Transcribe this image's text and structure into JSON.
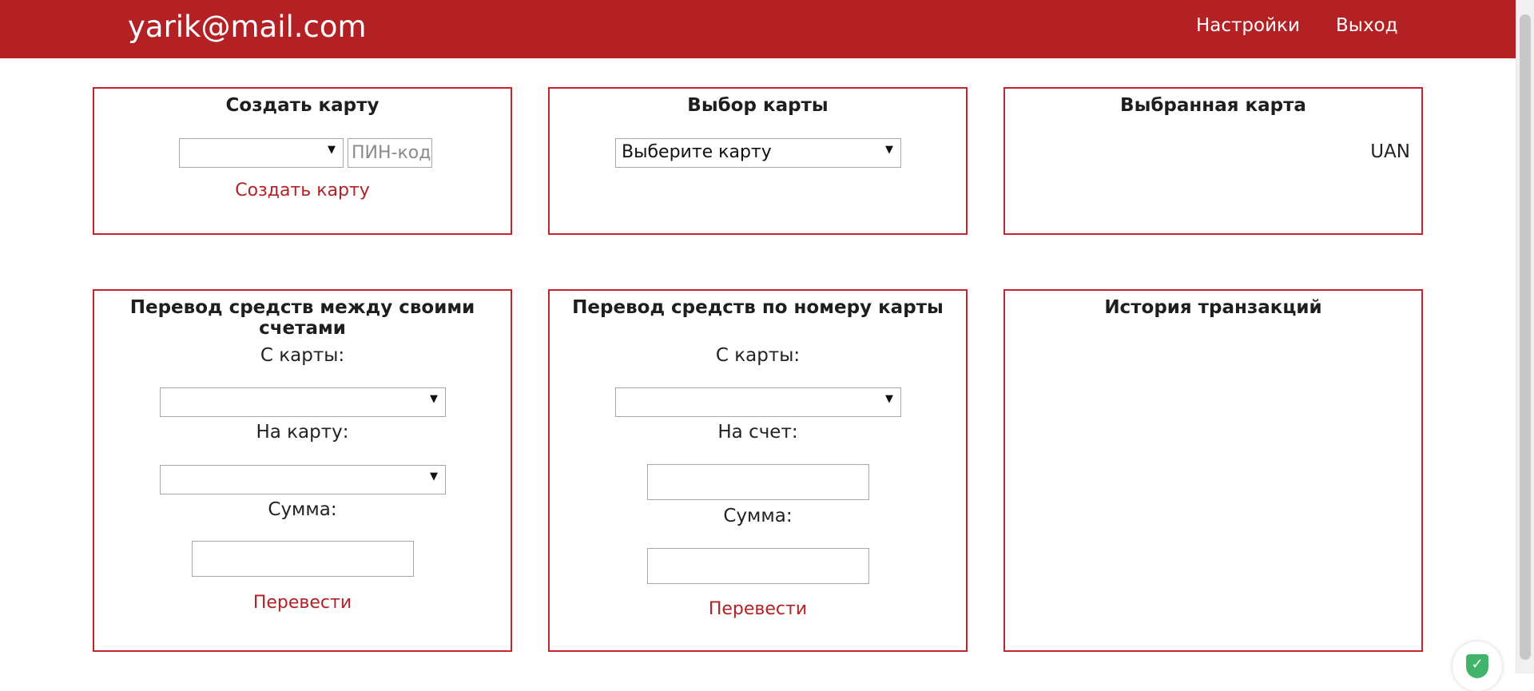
{
  "header": {
    "email": "yarik@mail.com",
    "nav": {
      "settings": "Настройки",
      "logout": "Выход"
    }
  },
  "create_card": {
    "title": "Создать карту",
    "currency_select_value": "",
    "pin_placeholder": "ПИН-код",
    "submit": "Создать карту"
  },
  "card_select": {
    "title": "Выбор карты",
    "select_value": "Выберите карту"
  },
  "selected_card": {
    "title": "Выбранная карта",
    "currency": "UAN"
  },
  "transfer_own": {
    "title": "Перевод средств между своими счетами",
    "from_label": "С карты:",
    "from_value": "",
    "to_label": "На карту:",
    "to_value": "",
    "amount_label": "Сумма:",
    "amount_value": "",
    "submit": "Перевести"
  },
  "transfer_card": {
    "title": "Перевод средств по номеру карты",
    "from_label": "С карты:",
    "from_value": "",
    "to_label": "На счет:",
    "to_value": "",
    "amount_label": "Сумма:",
    "amount_value": "",
    "submit": "Перевести"
  },
  "history": {
    "title": "История транзакций"
  },
  "icons": {
    "dropdown": "chevron-down-icon",
    "security_badge": "shield-check-icon"
  },
  "colors": {
    "brand": "#b32124",
    "panel_border": "#c0262b",
    "badge": "#41b36b"
  }
}
